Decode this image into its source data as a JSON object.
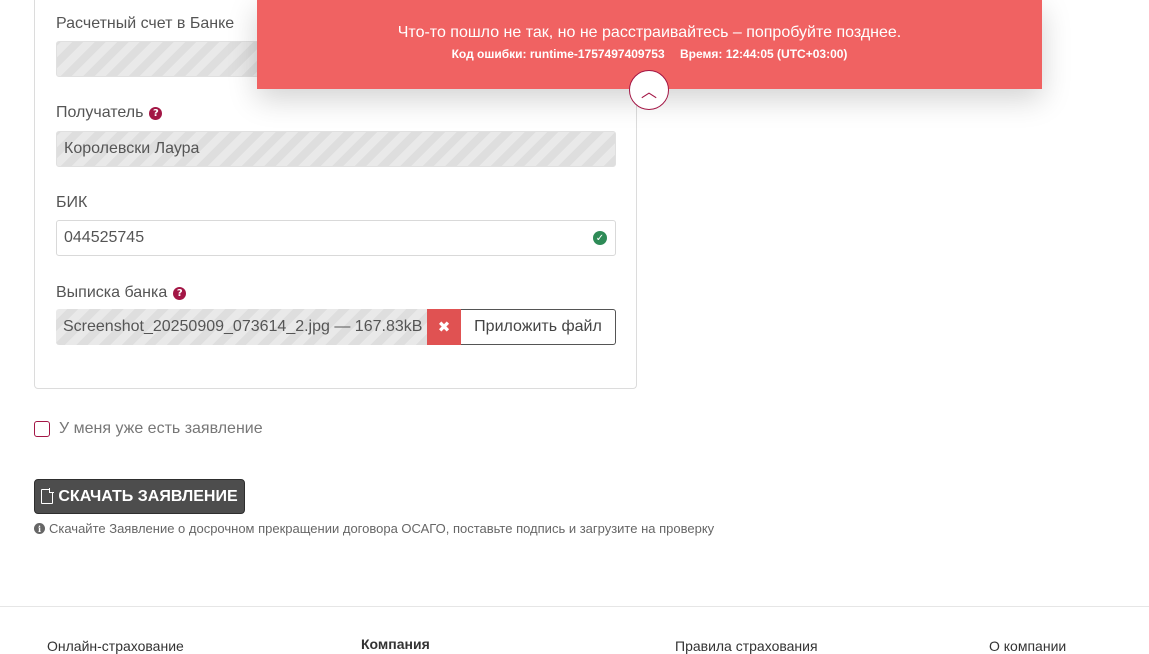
{
  "form": {
    "bank_account": {
      "label": "Расчетный счет в Банке",
      "value": ""
    },
    "recipient": {
      "label": "Получатель",
      "value": "Королевски Лаура"
    },
    "bik": {
      "label": "БИК",
      "value": "044525745"
    },
    "statement": {
      "label": "Выписка банка",
      "file_name": "Screenshot_20250909_073614_2.jpg — 167.83kB",
      "attach_label": "Приложить файл"
    }
  },
  "has_application_label": "У меня уже есть заявление",
  "download_button_label": "СКАЧАТЬ ЗАЯВЛЕНИЕ",
  "hint_text": "Скачайте Заявление о досрочном прекращении договора ОСАГО, поставьте подпись и загрузите на проверку",
  "footer": {
    "col1": "Онлайн-страхование",
    "col2": "Компания",
    "col3": "Правила страхования",
    "col4": "О компании"
  },
  "toast": {
    "message": "Что-то пошло не так, но не расстраивайтесь – попробуйте позднее.",
    "error_code": "Код ошибки: runtime-1757497409753",
    "time": "Время: 12:44:05 (UTC+03:00)"
  },
  "icons": {
    "help": "question-circle-icon",
    "valid": "check-circle-icon",
    "remove": "times-icon",
    "pdf": "file-pdf-icon",
    "info": "info-circle-icon",
    "collapse": "chevron-up-icon"
  },
  "colors": {
    "accent": "#a31645",
    "toast_bg": "#f06262",
    "remove_bg": "#e05252",
    "success": "#2e8b57",
    "dark_button": "#4d4d4d"
  }
}
